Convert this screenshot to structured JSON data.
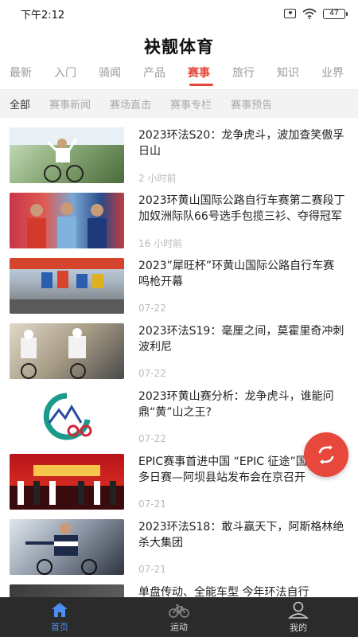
{
  "status_bar": {
    "time": "下午2:12",
    "battery": "47"
  },
  "app": {
    "title": "袂靓体育"
  },
  "main_tabs": [
    {
      "label": "最新"
    },
    {
      "label": "入门"
    },
    {
      "label": "骑闻"
    },
    {
      "label": "产品"
    },
    {
      "label": "赛事",
      "active": true
    },
    {
      "label": "旅行"
    },
    {
      "label": "知识"
    },
    {
      "label": "业界"
    }
  ],
  "sub_tabs": [
    {
      "label": "全部",
      "active": true
    },
    {
      "label": "赛事新闻"
    },
    {
      "label": "赛场直击"
    },
    {
      "label": "赛事专栏"
    },
    {
      "label": "赛事预告"
    }
  ],
  "news": [
    {
      "title": "2023环法S20：龙争虎斗，波加查笑傲孚日山",
      "time": "2 小时前"
    },
    {
      "title": "2023环黄山国际公路自行车赛第二赛段丁加奴洲际队66号选手包揽三衫、夺得冠军",
      "time": "16 小时前"
    },
    {
      "title": "2023”犀旺杯”环黄山国际公路自行车赛 鸣枪开幕",
      "time": "07-22"
    },
    {
      "title": "2023环法S19：毫厘之间，莫霍里奇冲刺波利尼",
      "time": "07-22"
    },
    {
      "title": "2023环黄山赛分析：龙争虎斗，谁能问鼎“黄”山之王?",
      "time": "07-22"
    },
    {
      "title": "EPIC赛事首进中国 “EPIC 征途”国际山地多日赛—阿坝县站发布会在京召开",
      "time": "07-21"
    },
    {
      "title": "2023环法S18：敢斗赢天下，阿斯格林绝杀大集团",
      "time": "07-21"
    },
    {
      "title": "单盘传动、全能车型 今年环法自行",
      "time": ""
    }
  ],
  "bottom_nav": [
    {
      "label": "首页",
      "icon": "home-icon",
      "active": true
    },
    {
      "label": "运动",
      "icon": "bicycle-icon"
    },
    {
      "label": "我的",
      "icon": "person-icon"
    }
  ],
  "colors": {
    "accent": "#e8473b",
    "nav_active": "#4b8df0",
    "nav_bg": "#2b2b2b"
  }
}
